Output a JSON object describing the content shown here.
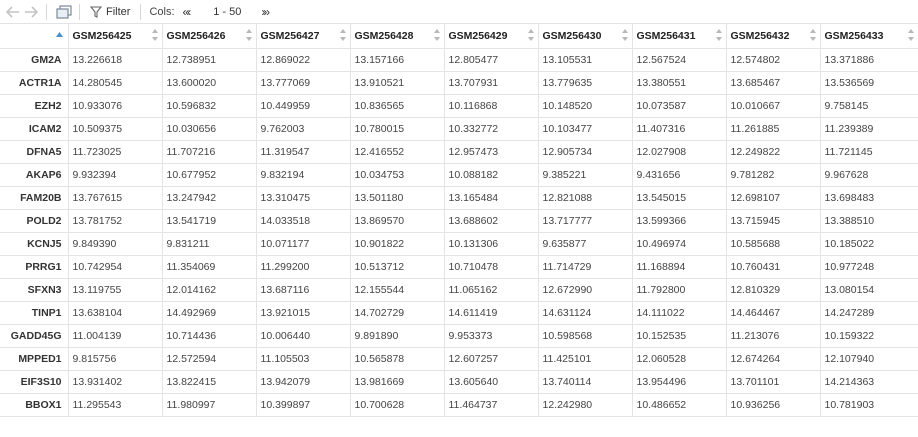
{
  "toolbar": {
    "filter_label": "Filter",
    "cols_label": "Cols:",
    "cols_prev": "«‹",
    "cols_range": "1 - 50",
    "cols_next": "›»",
    "icons": [
      "back-arrow-icon",
      "forward-arrow-icon",
      "popout-window-icon",
      "filter-funnel-icon"
    ]
  },
  "table": {
    "columns": [
      "GSM256425",
      "GSM256426",
      "GSM256427",
      "GSM256428",
      "GSM256429",
      "GSM256430",
      "GSM256431",
      "GSM256432",
      "GSM256433"
    ],
    "rows": [
      {
        "name": "GM2A",
        "values": [
          "13.226618",
          "12.738951",
          "12.869022",
          "13.157166",
          "12.805477",
          "13.105531",
          "12.567524",
          "12.574802",
          "13.371886"
        ]
      },
      {
        "name": "ACTR1A",
        "values": [
          "14.280545",
          "13.600020",
          "13.777069",
          "13.910521",
          "13.707931",
          "13.779635",
          "13.380551",
          "13.685467",
          "13.536569"
        ]
      },
      {
        "name": "EZH2",
        "values": [
          "10.933076",
          "10.596832",
          "10.449959",
          "10.836565",
          "10.116868",
          "10.148520",
          "10.073587",
          "10.010667",
          "9.758145"
        ]
      },
      {
        "name": "ICAM2",
        "values": [
          "10.509375",
          "10.030656",
          "9.762003",
          "10.780015",
          "10.332772",
          "10.103477",
          "11.407316",
          "11.261885",
          "11.239389"
        ]
      },
      {
        "name": "DFNA5",
        "values": [
          "11.723025",
          "11.707216",
          "11.319547",
          "12.416552",
          "12.957473",
          "12.905734",
          "12.027908",
          "12.249822",
          "11.721145"
        ]
      },
      {
        "name": "AKAP6",
        "values": [
          "9.932394",
          "10.677952",
          "9.832194",
          "10.034753",
          "10.088182",
          "9.385221",
          "9.431656",
          "9.781282",
          "9.967628"
        ]
      },
      {
        "name": "FAM20B",
        "values": [
          "13.767615",
          "13.247942",
          "13.310475",
          "13.501180",
          "13.165484",
          "12.821088",
          "13.545015",
          "12.698107",
          "13.698483"
        ]
      },
      {
        "name": "POLD2",
        "values": [
          "13.781752",
          "13.541719",
          "14.033518",
          "13.869570",
          "13.688602",
          "13.717777",
          "13.599366",
          "13.715945",
          "13.388510"
        ]
      },
      {
        "name": "KCNJ5",
        "values": [
          "9.849390",
          "9.831211",
          "10.071177",
          "10.901822",
          "10.131306",
          "9.635877",
          "10.496974",
          "10.585688",
          "10.185022"
        ]
      },
      {
        "name": "PRRG1",
        "values": [
          "10.742954",
          "11.354069",
          "11.299200",
          "10.513712",
          "10.710478",
          "11.714729",
          "11.168894",
          "10.760431",
          "10.977248"
        ]
      },
      {
        "name": "SFXN3",
        "values": [
          "13.119755",
          "12.014162",
          "13.687116",
          "12.155544",
          "11.065162",
          "12.672990",
          "11.792800",
          "12.810329",
          "13.080154"
        ]
      },
      {
        "name": "TINP1",
        "values": [
          "13.638104",
          "14.492969",
          "13.921015",
          "14.702729",
          "14.611419",
          "14.631124",
          "14.111022",
          "14.464467",
          "14.247289"
        ]
      },
      {
        "name": "GADD45G",
        "values": [
          "11.004139",
          "10.714436",
          "10.006440",
          "9.891890",
          "9.953373",
          "10.598568",
          "10.152535",
          "11.213076",
          "10.159322"
        ]
      },
      {
        "name": "MPPED1",
        "values": [
          "9.815756",
          "12.572594",
          "11.105503",
          "10.565878",
          "12.607257",
          "11.425101",
          "12.060528",
          "12.674264",
          "12.107940"
        ]
      },
      {
        "name": "EIF3S10",
        "values": [
          "13.931402",
          "13.822415",
          "13.942079",
          "13.981669",
          "13.605640",
          "13.740114",
          "13.954496",
          "13.701101",
          "14.214363"
        ]
      },
      {
        "name": "BBOX1",
        "values": [
          "11.295543",
          "11.980997",
          "10.399897",
          "10.700628",
          "11.464737",
          "12.242980",
          "10.486652",
          "10.936256",
          "10.781903"
        ]
      }
    ]
  },
  "colors": {
    "grid_line": "#e4e4e4",
    "sort_active": "#4a90c8",
    "sort_inactive": "#b8b8b8"
  }
}
